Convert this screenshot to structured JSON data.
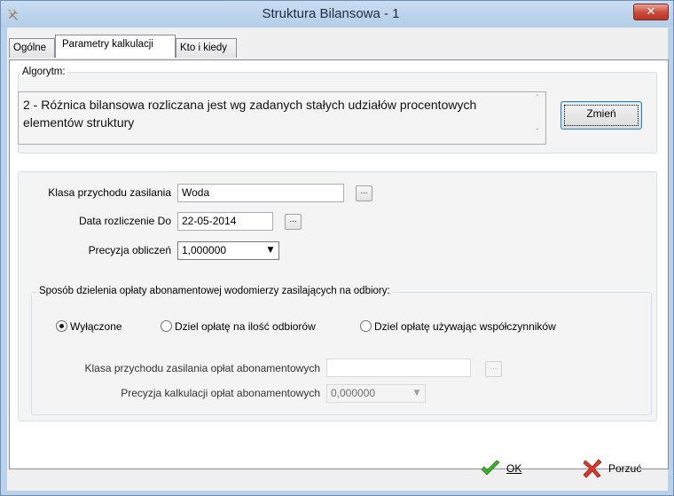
{
  "window": {
    "title": "Struktura Bilansowa - 1",
    "close_glyph": "✕"
  },
  "tabs": [
    {
      "label": "Ogólne"
    },
    {
      "label": "Parametry kalkulacji",
      "active": true
    },
    {
      "label": "Kto i kiedy"
    }
  ],
  "algorithm": {
    "legend": "Algorytm:",
    "text": "2 - Różnica bilansowa rozliczana jest wg zadanych stałych udziałów procentowych elementów struktury",
    "change_button_label": "Zmień",
    "scroll_up_glyph": "˄",
    "scroll_down_glyph": "˅"
  },
  "fields": {
    "klasa_label": "Klasa przychodu zasilania",
    "klasa_value": "Woda",
    "data_label": "Data rozliczenie Do",
    "data_value": "22-05-2014",
    "precyzja_label": "Precyzja obliczeń",
    "precyzja_value": "1,000000",
    "ellipsis": "..."
  },
  "abonament": {
    "legend": "Sposób dzielenia opłaty abonamentowej wodomierzy zasilających na odbiory:",
    "options": [
      {
        "label": "Wyłączone",
        "checked": true
      },
      {
        "label": "Dziel opłatę na ilość odbiorów",
        "checked": false
      },
      {
        "label": "Dziel opłatę używając współczynników",
        "checked": false
      }
    ],
    "klasa_label": "Klasa przychodu zasilania opłat abonamentowych",
    "klasa_value": "",
    "precyzja_label": "Precyzja kalkulacji opłat abonamentowych",
    "precyzja_value": "0,000000"
  },
  "footer": {
    "ok_label": "OK",
    "cancel_label": "Porzuć"
  },
  "colors": {
    "ok_icon": "#3fae2a",
    "cancel_icon": "#d93a2b"
  }
}
